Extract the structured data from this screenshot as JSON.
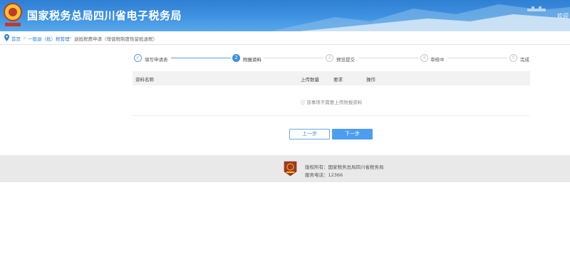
{
  "header": {
    "site_title": "国家税务总局四川省电子税务局",
    "welcome_text": "欢迎"
  },
  "breadcrumb": {
    "items": [
      "首页",
      "一般退（抵）税管理",
      "退抵税费申请（增值税制度性留抵退税）"
    ]
  },
  "steps": [
    {
      "number": "1",
      "label": "填写申请表",
      "status": "done"
    },
    {
      "number": "2",
      "label": "附报资料",
      "status": "active"
    },
    {
      "number": "3",
      "label": "预览提交",
      "status": "pending"
    },
    {
      "number": "4",
      "label": "审核中",
      "status": "pending"
    },
    {
      "number": "5",
      "label": "完成",
      "status": "pending"
    }
  ],
  "table": {
    "columns": [
      "资料名称",
      "上传数量",
      "要求",
      "操作"
    ],
    "empty_message": "该事项不需要上传附报资料"
  },
  "buttons": {
    "prev": "上一步",
    "next": "下一步"
  },
  "footer": {
    "copyright": "版权所有：国家税务总局四川省税务局",
    "hotline": "服务电话：12366"
  },
  "colors": {
    "primary": "#3a8ee6",
    "header_bg": "#3f93e2",
    "footer_bg": "#e9e9e9"
  }
}
